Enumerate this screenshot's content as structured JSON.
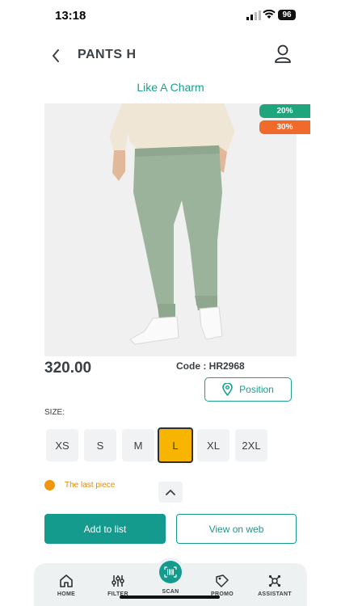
{
  "status": {
    "time": "13:18",
    "battery": "96"
  },
  "header": {
    "title": "PANTS H"
  },
  "product": {
    "brand": "Like A Charm",
    "discounts": [
      "20%",
      "30%"
    ],
    "price": "320.00",
    "code": "Code : HR2968",
    "position_label": "Position"
  },
  "sizes": {
    "label": "SIZE:",
    "options": [
      "XS",
      "S",
      "M",
      "L",
      "XL",
      "2XL"
    ],
    "selected": "L"
  },
  "stock": {
    "text": "The last piece"
  },
  "actions": {
    "add_label": "Add to list",
    "web_label": "View on web"
  },
  "tabs": [
    {
      "label": "HOME",
      "icon": "home-icon"
    },
    {
      "label": "FILTER",
      "icon": "filter-icon"
    },
    {
      "label": "SCAN",
      "icon": "barcode-icon"
    },
    {
      "label": "PROMO",
      "icon": "tag-icon"
    },
    {
      "label": "ASSISTANT",
      "icon": "assistant-icon"
    }
  ],
  "colors": {
    "accent": "#149b8e",
    "badge_green": "#1ea57c",
    "badge_orange": "#f06a2c",
    "selected_size": "#f7b500",
    "stock_dot": "#f2950c"
  }
}
